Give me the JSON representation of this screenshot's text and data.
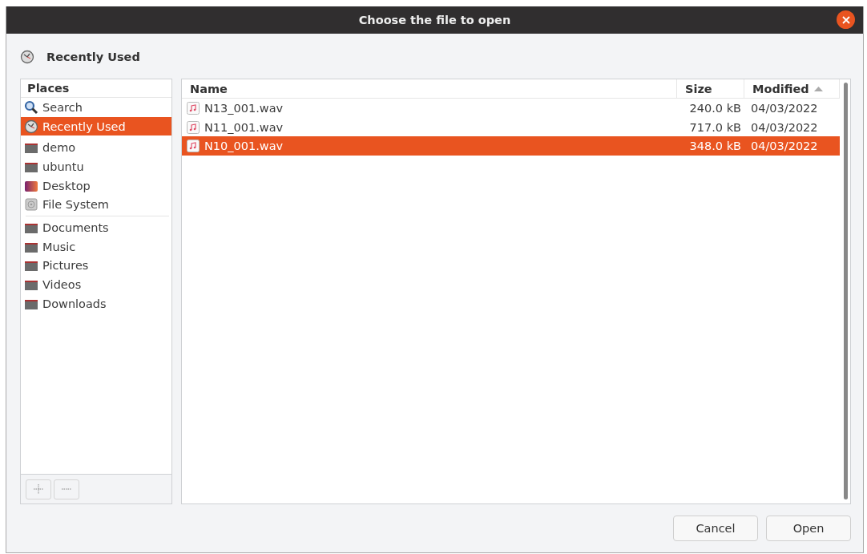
{
  "window": {
    "title": "Choose the file to open"
  },
  "location": {
    "label": "Recently Used"
  },
  "places": {
    "header": "Places",
    "sections": [
      {
        "items": [
          {
            "label": "Search",
            "kind": "search",
            "selected": false
          },
          {
            "label": "Recently Used",
            "kind": "recent",
            "selected": true
          }
        ]
      },
      {
        "items": [
          {
            "label": "demo",
            "kind": "folder",
            "selected": false
          },
          {
            "label": "ubuntu",
            "kind": "folder",
            "selected": false
          },
          {
            "label": "Desktop",
            "kind": "desktop",
            "selected": false
          },
          {
            "label": "File System",
            "kind": "drive",
            "selected": false
          }
        ]
      },
      {
        "items": [
          {
            "label": "Documents",
            "kind": "folder",
            "selected": false
          },
          {
            "label": "Music",
            "kind": "folder",
            "selected": false
          },
          {
            "label": "Pictures",
            "kind": "folder",
            "selected": false
          },
          {
            "label": "Videos",
            "kind": "folder",
            "selected": false
          },
          {
            "label": "Downloads",
            "kind": "folder",
            "selected": false
          }
        ]
      }
    ]
  },
  "files": {
    "columns": [
      {
        "label": "Name",
        "sorted": false
      },
      {
        "label": "Size",
        "sorted": false
      },
      {
        "label": "Modified",
        "sorted": true
      }
    ],
    "rows": [
      {
        "name": "N13_001.wav",
        "size": "240.0 kB",
        "modified": "04/03/2022",
        "selected": false
      },
      {
        "name": "N11_001.wav",
        "size": "717.0 kB",
        "modified": "04/03/2022",
        "selected": false
      },
      {
        "name": "N10_001.wav",
        "size": "348.0 kB",
        "modified": "04/03/2022",
        "selected": true
      }
    ]
  },
  "buttons": [
    "Cancel",
    "Open"
  ]
}
